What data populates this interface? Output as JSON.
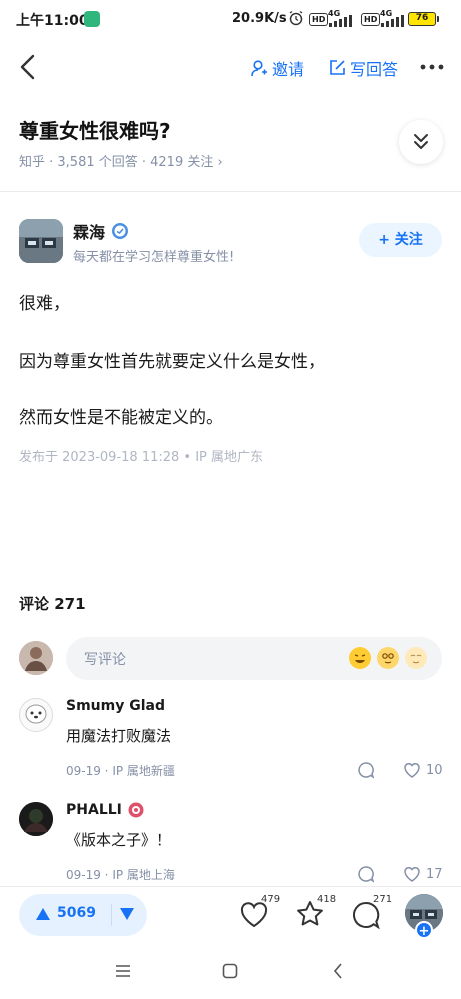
{
  "status_bar": {
    "time": "上午11:00",
    "speed": "20.9K/s",
    "hd": "HD",
    "net": "4G",
    "battery": "76"
  },
  "nav": {
    "invite_label": "邀请",
    "write_answer_label": "写回答"
  },
  "question": {
    "title": "尊重女性很难吗?",
    "meta": "知乎 · 3,581 个回答 · 4219 关注 ›"
  },
  "author": {
    "name": "霖海",
    "bio": "每天都在学习怎样尊重女性!",
    "follow_label": "+ 关注"
  },
  "answer": {
    "paragraphs": [
      "很难，",
      "因为尊重女性首先就要定义什么是女性，",
      "然而女性是不能被定义的。"
    ],
    "published": "发布于 2023-09-18 11:28 • IP 属地广东"
  },
  "comments": {
    "title": "评论 271",
    "placeholder": "写评论",
    "items": [
      {
        "name": "Smumy Glad",
        "text": "用魔法打败魔法",
        "meta": "09-19 · IP 属地新疆",
        "likes": "10"
      },
      {
        "name": "PHALLI",
        "text": "《版本之子》！",
        "meta": "09-19 · IP 属地上海",
        "likes": "17"
      }
    ]
  },
  "bottom_bar": {
    "votes": "5069",
    "like_count": "479",
    "favorite_count": "418",
    "comment_count": "271"
  },
  "colors": {
    "accent": "#1772f6",
    "muted": "#8590a6"
  },
  "icons": [
    "back-icon",
    "invite-person-icon",
    "write-icon",
    "more-icon",
    "chevron-double-down-icon",
    "verified-badge-icon",
    "heart-icon",
    "star-icon",
    "comment-bubble-icon",
    "vote-up-icon",
    "vote-down-icon"
  ]
}
